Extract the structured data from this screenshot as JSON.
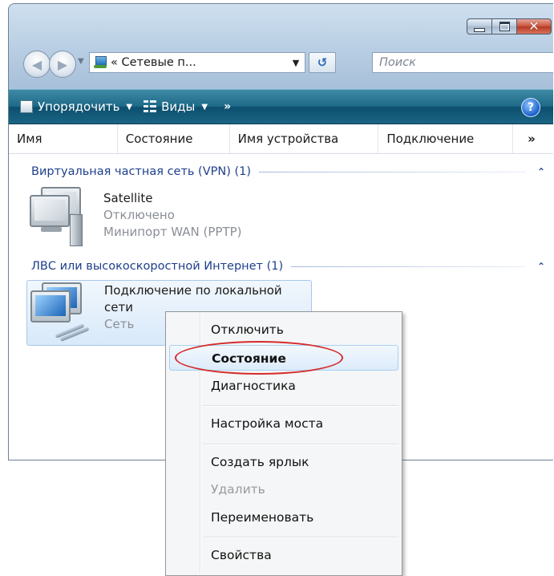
{
  "window": {
    "address_text": "« Сетевые п...",
    "search_placeholder": "Поиск"
  },
  "toolbar": {
    "organize_label": "Упорядочить",
    "views_label": "Виды",
    "more_label": "»",
    "help_label": "?"
  },
  "columns": [
    {
      "label": "Имя"
    },
    {
      "label": "Состояние"
    },
    {
      "label": "Имя устройства"
    },
    {
      "label": "Подключение"
    },
    {
      "label": "»"
    }
  ],
  "groups": [
    {
      "title": "Виртуальная частная сеть (VPN) (1)",
      "items": [
        {
          "name": "Satellite",
          "status": "Отключено",
          "device": "Минипорт WAN (PPTP)"
        }
      ]
    },
    {
      "title": "ЛВС или высокоскоростной Интернет (1)",
      "items": [
        {
          "name_line1": "Подключение по локальной",
          "name_line2": "сети",
          "status": "Сеть"
        }
      ]
    }
  ],
  "context_menu": {
    "items": [
      {
        "label": "Отключить"
      },
      {
        "label": "Состояние"
      },
      {
        "label": "Диагностика"
      },
      {
        "label": "Настройка моста"
      },
      {
        "label": "Создать ярлык"
      },
      {
        "label": "Удалить"
      },
      {
        "label": "Переименовать"
      },
      {
        "label": "Свойства"
      }
    ]
  },
  "colors": {
    "command_bar": "#1e6a88",
    "group_header": "#1e3f8c",
    "annotation": "#d42b2b",
    "close_button": "#c8513b"
  }
}
